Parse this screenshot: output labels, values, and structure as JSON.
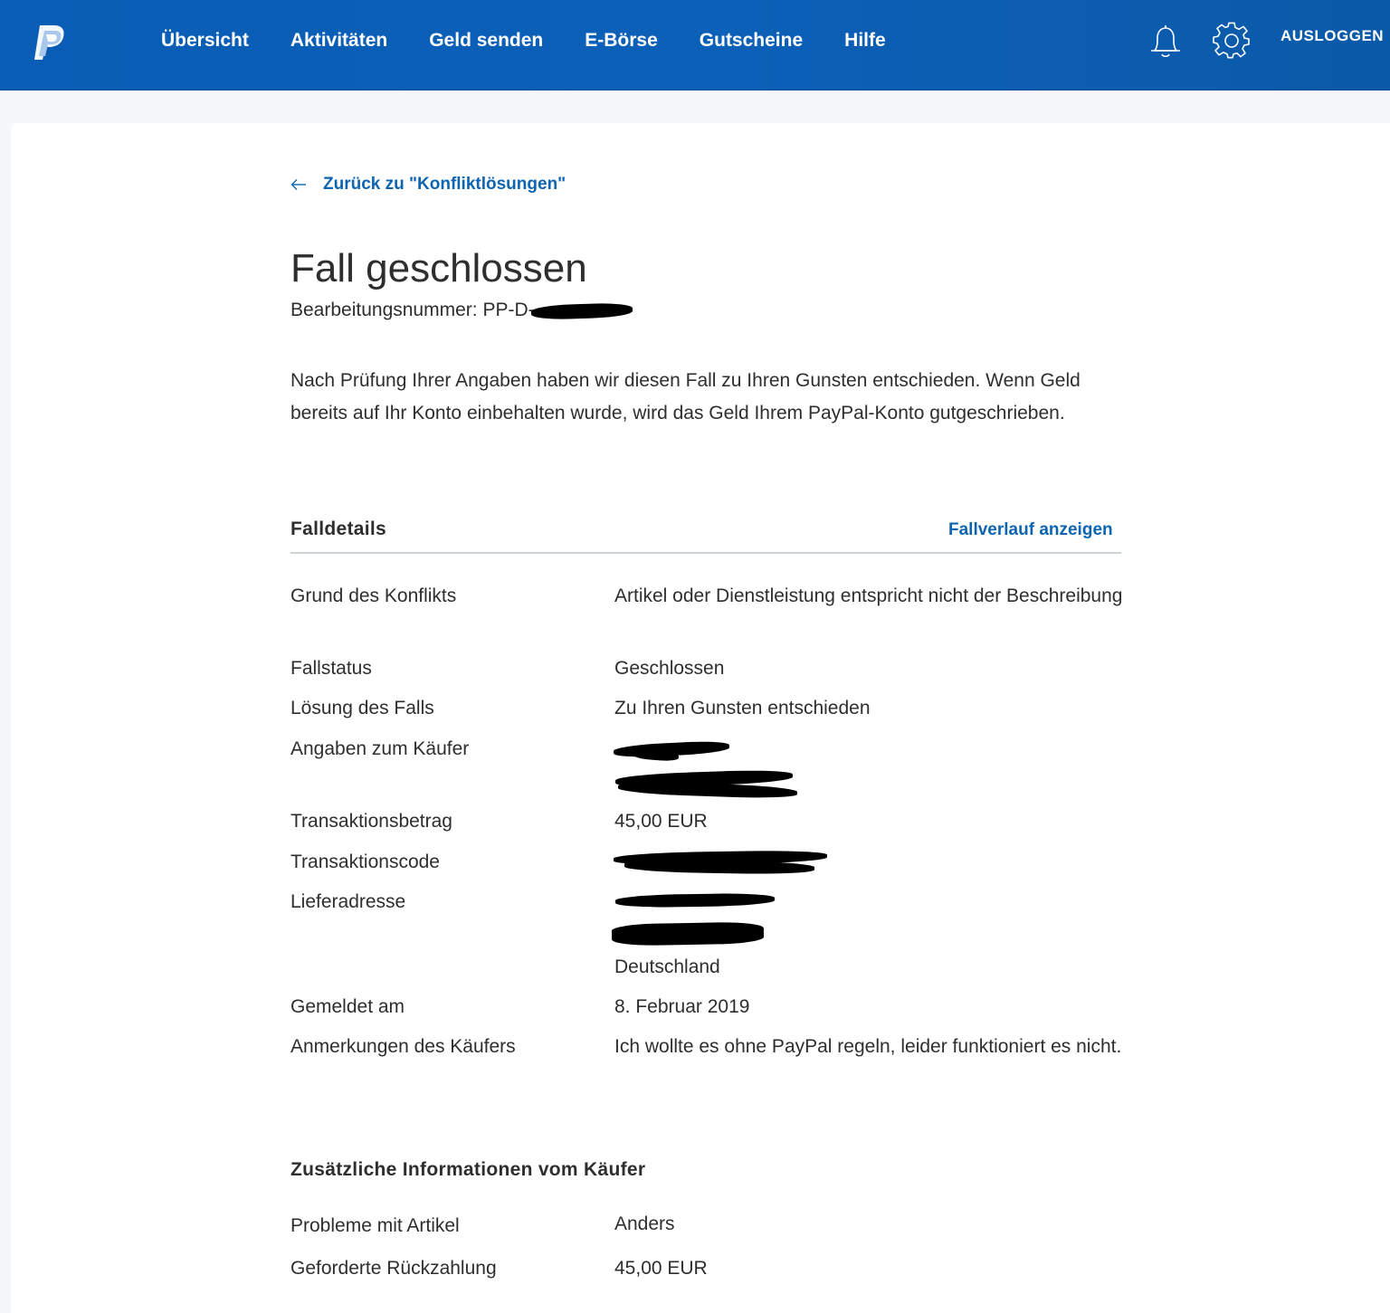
{
  "nav": {
    "items": [
      "Übersicht",
      "Aktivitäten",
      "Geld senden",
      "E-Börse",
      "Gutscheine",
      "Hilfe"
    ],
    "logout": "AUSLOGGEN"
  },
  "page": {
    "back_link": "Zurück zu \"Konfliktlösungen\"",
    "title": "Fall geschlossen",
    "case_number_prefix": "Bearbeitungsnummer: PP-D-",
    "intro": "Nach Prüfung Ihrer Angaben haben wir diesen Fall zu Ihren Gunsten entschieden. Wenn Geld bereits auf Ihr Konto einbehalten wurde, wird das Geld Ihrem PayPal-Konto gutgeschrieben."
  },
  "details": {
    "heading": "Falldetails",
    "history_link": "Fallverlauf anzeigen",
    "rows": [
      {
        "label": "Grund des Konflikts",
        "value": "Artikel oder Dienstleistung entspricht nicht der Beschreibung"
      },
      {
        "label": "Fallstatus",
        "value": "Geschlossen"
      },
      {
        "label": "Lösung des Falls",
        "value": "Zu Ihren Gunsten entschieden"
      },
      {
        "label": "Angaben zum Käufer",
        "value": ""
      },
      {
        "label": "Transaktionsbetrag",
        "value": "45,00 EUR"
      },
      {
        "label": "Transaktionscode",
        "value": ""
      },
      {
        "label": "Lieferadresse",
        "value": "Deutschland"
      },
      {
        "label": "Gemeldet am",
        "value": "8. Februar 2019"
      },
      {
        "label": "Anmerkungen des Käufers",
        "value": "Ich wollte es ohne PayPal regeln, leider funktioniert es nicht."
      }
    ]
  },
  "additional": {
    "heading": "Zusätzliche Informationen vom Käufer",
    "rows": [
      {
        "label": "Probleme mit Artikel",
        "value": "Anders"
      },
      {
        "label": "Geforderte Rückzahlung",
        "value": "45,00 EUR"
      }
    ]
  },
  "colors": {
    "header_blue": "#0c60b8",
    "link_blue": "#0d65b2",
    "text": "#2c2e2f"
  },
  "icons": [
    "paypal-logo-icon",
    "bell-icon",
    "gear-icon",
    "arrow-left-icon"
  ]
}
